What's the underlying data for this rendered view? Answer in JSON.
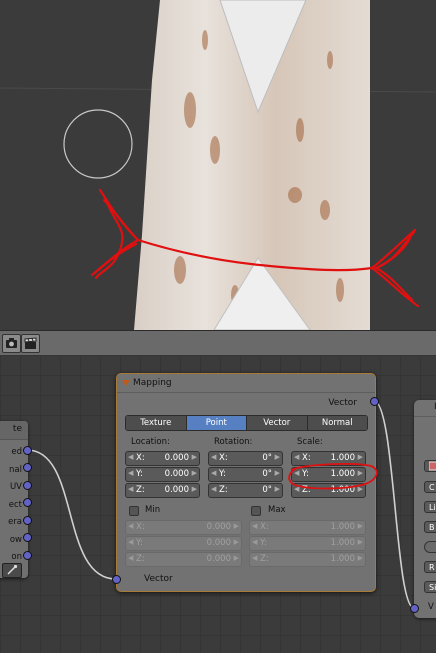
{
  "left_node": {
    "header_fragment": "te",
    "outputs": [
      "ed",
      "nal",
      "UV",
      "ect",
      "era",
      "ow",
      "on"
    ]
  },
  "mapping": {
    "title": "Mapping",
    "output_label": "Vector",
    "input_label": "Vector",
    "tabs": [
      "Texture",
      "Point",
      "Vector",
      "Normal"
    ],
    "active_tab": "Point",
    "location": {
      "label": "Location:",
      "fields": [
        {
          "axis": "X:",
          "value": "0.000"
        },
        {
          "axis": "Y:",
          "value": "0.000"
        },
        {
          "axis": "Z:",
          "value": "0.000"
        }
      ]
    },
    "rotation": {
      "label": "Rotation:",
      "fields": [
        {
          "axis": "X:",
          "value": "0°"
        },
        {
          "axis": "Y:",
          "value": "0°"
        },
        {
          "axis": "Z:",
          "value": "0°"
        }
      ]
    },
    "scale": {
      "label": "Scale:",
      "fields": [
        {
          "axis": "X:",
          "value": "1.000"
        },
        {
          "axis": "Y:",
          "value": "1.000"
        },
        {
          "axis": "Z:",
          "value": "1.000"
        }
      ]
    },
    "min": {
      "label": "Min",
      "fields": [
        {
          "axis": "X:",
          "value": "0.000"
        },
        {
          "axis": "Y:",
          "value": "0.000"
        },
        {
          "axis": "Z:",
          "value": "0.000"
        }
      ]
    },
    "max": {
      "label": "Max",
      "fields": [
        {
          "axis": "X:",
          "value": "1.000"
        },
        {
          "axis": "Y:",
          "value": "1.000"
        },
        {
          "axis": "Z:",
          "value": "1.000"
        }
      ]
    }
  },
  "right_node": {
    "header_fragment": "I",
    "buttons": [
      "C",
      "Li",
      "B",
      "R",
      "Si"
    ],
    "input_label": "V"
  },
  "colors": {
    "active_tab": "#5680c2",
    "node_selected_outline": "#a77b35",
    "vector_socket": "#6363c7",
    "annotation_red": "#e01010"
  }
}
